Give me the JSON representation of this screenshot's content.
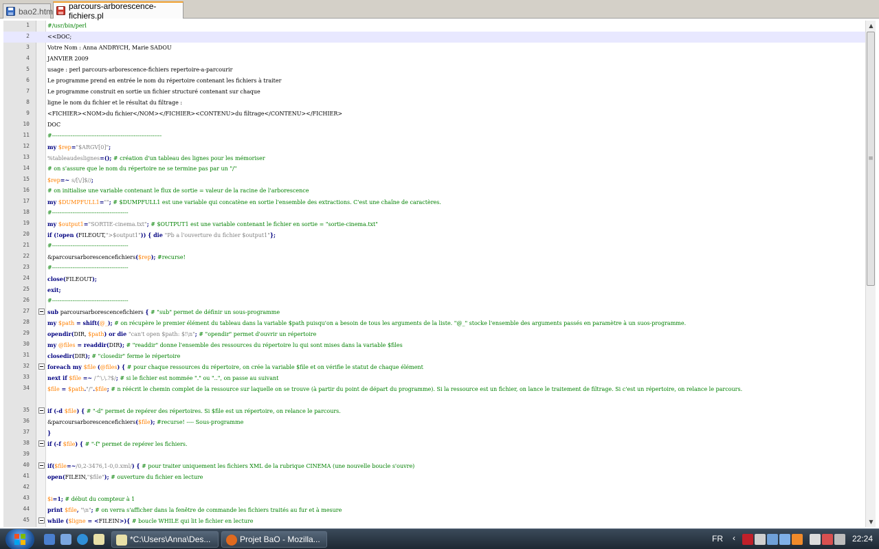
{
  "tabs": [
    {
      "label": "bao2.htm",
      "active": false
    },
    {
      "label": "parcours-arborescence-fichiers.pl",
      "active": true
    }
  ],
  "editor": {
    "current_line": 2,
    "lines": [
      {
        "n": "1",
        "fold": false,
        "segs": [
          [
            "comment",
            "#/usr/bin/perl"
          ]
        ]
      },
      {
        "n": "2",
        "fold": false,
        "segs": [
          [
            "plain",
            "<<DOC;"
          ]
        ]
      },
      {
        "n": "3",
        "fold": false,
        "segs": [
          [
            "plain",
            "Votre Nom : Anna ANDRYCH, Marie SADOU"
          ]
        ]
      },
      {
        "n": "4",
        "fold": false,
        "segs": [
          [
            "plain",
            "JANVIER 2009"
          ]
        ]
      },
      {
        "n": "5",
        "fold": false,
        "segs": [
          [
            "plain",
            "usage : perl parcours-arborescence-fichiers repertoire-a-parcourir"
          ]
        ]
      },
      {
        "n": "6",
        "fold": false,
        "segs": [
          [
            "plain",
            "Le programme prend en entrée le nom du répertoire contenant les fichiers à traiter"
          ]
        ]
      },
      {
        "n": "7",
        "fold": false,
        "segs": [
          [
            "plain",
            "Le programme construit en sortie un fichier structuré contenant sur chaque"
          ]
        ]
      },
      {
        "n": "8",
        "fold": false,
        "segs": [
          [
            "plain",
            "ligne le nom du fichier et le résultat du filtrage :"
          ]
        ]
      },
      {
        "n": "9",
        "fold": false,
        "segs": [
          [
            "plain",
            "<FICHIER><NOM>du fichier</NOM></FICHIER><CONTENU>du filtrage</CONTENU></FICHIER>"
          ]
        ]
      },
      {
        "n": "10",
        "fold": false,
        "segs": [
          [
            "plain",
            "DOC"
          ]
        ]
      },
      {
        "n": "11",
        "fold": false,
        "segs": [
          [
            "comment",
            "#-----------------------------------------------------------"
          ]
        ]
      },
      {
        "n": "12",
        "fold": false,
        "segs": [
          [
            "kw",
            "my "
          ],
          [
            "var",
            "$rep"
          ],
          [
            "op",
            "="
          ],
          [
            "str",
            "\"$ARGV[0]\""
          ],
          [
            "op",
            ";"
          ]
        ]
      },
      {
        "n": "13",
        "fold": false,
        "segs": [
          [
            "str",
            "%tableaudeslignes"
          ],
          [
            "op",
            "=();"
          ],
          [
            "comment",
            " # création d'un tableau des lignes pour les mémoriser"
          ]
        ]
      },
      {
        "n": "14",
        "fold": false,
        "segs": [
          [
            "comment",
            "# on s'assure que le nom du répertoire ne se termine pas par un \"/\""
          ]
        ]
      },
      {
        "n": "15",
        "fold": false,
        "segs": [
          [
            "var",
            "$rep"
          ],
          [
            "op",
            "=~ "
          ],
          [
            "str",
            "s/[\\/]$//"
          ],
          [
            "op",
            ";"
          ]
        ]
      },
      {
        "n": "16",
        "fold": false,
        "segs": [
          [
            "comment",
            "# on initialise une variable contenant le flux de sortie = valeur de la racine de l'arborescence"
          ]
        ]
      },
      {
        "n": "17",
        "fold": false,
        "segs": [
          [
            "kw",
            "my "
          ],
          [
            "var",
            "$DUMPFULL1"
          ],
          [
            "op",
            "="
          ],
          [
            "str",
            "\"\""
          ],
          [
            "op",
            ";"
          ],
          [
            "comment",
            " # $DUMPFULL1 est une variable qui concatène en sortie l'ensemble des extractions. C'est une chaîne de caractères."
          ]
        ]
      },
      {
        "n": "18",
        "fold": false,
        "segs": [
          [
            "comment",
            "#-----------------------------------------"
          ]
        ]
      },
      {
        "n": "19",
        "fold": false,
        "segs": [
          [
            "kw",
            "my "
          ],
          [
            "var",
            "$output1"
          ],
          [
            "op",
            "="
          ],
          [
            "str",
            "\"SORTIE-cinema.txt\""
          ],
          [
            "op",
            ";"
          ],
          [
            "comment",
            " # $OUTPUT1 est une variable contenant le fichier en sortie = \"sortie-cinema.txt\""
          ]
        ]
      },
      {
        "n": "20",
        "fold": false,
        "segs": [
          [
            "kw",
            "if "
          ],
          [
            "op",
            "(!"
          ],
          [
            "kw",
            "open "
          ],
          [
            "op",
            "("
          ],
          [
            "plain",
            "FILEOUT,"
          ],
          [
            "str",
            "\">$output1\""
          ],
          [
            "op",
            ")) { "
          ],
          [
            "kw",
            "die "
          ],
          [
            "str",
            "\"Pb a l'ouverture du fichier $output1\""
          ],
          [
            "op",
            "};"
          ]
        ]
      },
      {
        "n": "21",
        "fold": false,
        "segs": [
          [
            "comment",
            "#-----------------------------------------"
          ]
        ]
      },
      {
        "n": "22",
        "fold": false,
        "segs": [
          [
            "plain",
            "&parcoursarborescencefichiers"
          ],
          [
            "op",
            "("
          ],
          [
            "var",
            "$rep"
          ],
          [
            "op",
            ");"
          ],
          [
            "comment",
            " #recurse!"
          ]
        ]
      },
      {
        "n": "23",
        "fold": false,
        "segs": [
          [
            "comment",
            "#-----------------------------------------"
          ]
        ]
      },
      {
        "n": "24",
        "fold": false,
        "segs": [
          [
            "kw",
            "close"
          ],
          [
            "op",
            "("
          ],
          [
            "plain",
            "FILEOUT"
          ],
          [
            "op",
            ");"
          ]
        ]
      },
      {
        "n": "25",
        "fold": false,
        "segs": [
          [
            "kw",
            "exit"
          ],
          [
            "op",
            ";"
          ]
        ]
      },
      {
        "n": "26",
        "fold": false,
        "segs": [
          [
            "comment",
            "#-----------------------------------------"
          ]
        ]
      },
      {
        "n": "27",
        "fold": true,
        "segs": [
          [
            "kw",
            "sub "
          ],
          [
            "plain",
            "parcoursarborescencefichiers "
          ],
          [
            "op",
            "{"
          ],
          [
            "comment",
            " # \"sub\" permet de définir un sous-programme"
          ]
        ]
      },
      {
        "n": "28",
        "fold": false,
        "segs": [
          [
            "kw",
            "my "
          ],
          [
            "var",
            "$path"
          ],
          [
            "op",
            " = "
          ],
          [
            "kw",
            "shift"
          ],
          [
            "op",
            "("
          ],
          [
            "var",
            "@_"
          ],
          [
            "op",
            ");"
          ],
          [
            "comment",
            " # on récupère le premier élément du tableau dans la variable $path puisqu'on a besoin de tous les arguments de la liste. \"@_\" stocke l'ensemble des arguments passés en paramètre à un suos-programme."
          ]
        ]
      },
      {
        "n": "29",
        "fold": false,
        "segs": [
          [
            "kw",
            "opendir"
          ],
          [
            "op",
            "("
          ],
          [
            "plain",
            "DIR, "
          ],
          [
            "var",
            "$path"
          ],
          [
            "op",
            ") "
          ],
          [
            "kw",
            "or die "
          ],
          [
            "str",
            "\"can't open $path: $!\\n\""
          ],
          [
            "op",
            ";"
          ],
          [
            "comment",
            " # \"opendir\" permet d'ouvrir un répertoire"
          ]
        ]
      },
      {
        "n": "30",
        "fold": false,
        "segs": [
          [
            "kw",
            "my "
          ],
          [
            "var",
            "@files"
          ],
          [
            "op",
            " = "
          ],
          [
            "kw",
            "readdir"
          ],
          [
            "op",
            "("
          ],
          [
            "plain",
            "DIR"
          ],
          [
            "op",
            ");"
          ],
          [
            "comment",
            " # \"readdir\" donne l'ensemble des ressources du répertoire lu qui sont mises dans la variable $files"
          ]
        ]
      },
      {
        "n": "31",
        "fold": false,
        "segs": [
          [
            "kw",
            "closedir"
          ],
          [
            "op",
            "("
          ],
          [
            "plain",
            "DIR"
          ],
          [
            "op",
            ");"
          ],
          [
            "comment",
            " # \"closedir\" ferme le répertoire"
          ]
        ]
      },
      {
        "n": "32",
        "fold": true,
        "segs": [
          [
            "kw",
            "foreach my "
          ],
          [
            "var",
            "$file "
          ],
          [
            "op",
            "("
          ],
          [
            "var",
            "@files"
          ],
          [
            "op",
            ") {"
          ],
          [
            "comment",
            " # pour chaque ressources du répertoire, on crée la variable $file et on vérifie le statut de chaque élément"
          ]
        ]
      },
      {
        "n": "33",
        "fold": false,
        "segs": [
          [
            "kw",
            "next if "
          ],
          [
            "var",
            "$file "
          ],
          [
            "op",
            "=~ "
          ],
          [
            "str",
            "/^\\.\\.?$/"
          ],
          [
            "op",
            ";"
          ],
          [
            "comment",
            " # si le fichier est nommée \".\" ou \"..\", on passe au suivant"
          ]
        ]
      },
      {
        "n": "34",
        "fold": false,
        "wrap": true,
        "segs": [
          [
            "var",
            "$file"
          ],
          [
            "op",
            " = "
          ],
          [
            "var",
            "$path"
          ],
          [
            "op",
            "."
          ],
          [
            "str",
            "\"/\""
          ],
          [
            "op",
            "."
          ],
          [
            "var",
            "$file"
          ],
          [
            "op",
            ";"
          ],
          [
            "comment",
            " # n réécrit le chemin complet de la ressource sur laquelle on se trouve (à partir du point de départ du programme). Si la ressource est un fichier, on lance le traitement de filtrage. Si c'est un répertoire, on relance le parcours."
          ]
        ]
      },
      {
        "n": "35",
        "fold": true,
        "segs": [
          [
            "kw",
            "if "
          ],
          [
            "op",
            "(-d "
          ],
          [
            "var",
            "$file"
          ],
          [
            "op",
            ") {"
          ],
          [
            "comment",
            " # \"-d\" permet de repérer des répertoires. Si $file est un répertoire, on relance le parcours."
          ]
        ]
      },
      {
        "n": "36",
        "fold": false,
        "segs": [
          [
            "plain",
            "&parcoursarborescencefichiers"
          ],
          [
            "op",
            "("
          ],
          [
            "var",
            "$file"
          ],
          [
            "op",
            ");"
          ],
          [
            "comment",
            " #recurse! ---- Sous-programme"
          ]
        ]
      },
      {
        "n": "37",
        "fold": false,
        "segs": [
          [
            "op",
            "}"
          ]
        ]
      },
      {
        "n": "38",
        "fold": true,
        "segs": [
          [
            "kw",
            "if "
          ],
          [
            "op",
            "(-f "
          ],
          [
            "var",
            "$file"
          ],
          [
            "op",
            ") {"
          ],
          [
            "comment",
            " # \"-f\" permet de repérer les fichiers."
          ]
        ]
      },
      {
        "n": "39",
        "fold": false,
        "segs": []
      },
      {
        "n": "40",
        "fold": true,
        "segs": [
          [
            "kw",
            "if"
          ],
          [
            "op",
            "("
          ],
          [
            "var",
            "$file"
          ],
          [
            "op",
            "=~"
          ],
          [
            "str",
            "/0,2-3476,1-0,0.xml/"
          ],
          [
            "op",
            ") {"
          ],
          [
            "comment",
            " # pour traiter uniquement les fichiers XML de la rubrique CINEMA (une nouvelle boucle s'ouvre)"
          ]
        ]
      },
      {
        "n": "41",
        "fold": false,
        "segs": [
          [
            "kw",
            "open"
          ],
          [
            "op",
            "("
          ],
          [
            "plain",
            "FILEIN,"
          ],
          [
            "str",
            "\"$file\""
          ],
          [
            "op",
            ");"
          ],
          [
            "comment",
            " # ouverture du fichier en lecture"
          ]
        ]
      },
      {
        "n": "42",
        "fold": false,
        "segs": []
      },
      {
        "n": "43",
        "fold": false,
        "segs": [
          [
            "var",
            "$i"
          ],
          [
            "op",
            "=1;"
          ],
          [
            "comment",
            " # début du compteur à 1"
          ]
        ]
      },
      {
        "n": "44",
        "fold": false,
        "segs": [
          [
            "kw",
            "print "
          ],
          [
            "var",
            "$file"
          ],
          [
            "op",
            ", "
          ],
          [
            "str",
            "\"\\n\""
          ],
          [
            "op",
            ";"
          ],
          [
            "comment",
            " # on verra s'afficher dans la fenêtre de commande les fichiers traités au fur et à mesure"
          ]
        ]
      },
      {
        "n": "45",
        "fold": true,
        "segs": [
          [
            "kw",
            "while "
          ],
          [
            "op",
            "("
          ],
          [
            "var",
            "$ligne"
          ],
          [
            "op",
            " = <"
          ],
          [
            "plain",
            "FILEIN"
          ],
          [
            "op",
            ">){"
          ],
          [
            "comment",
            " # boucle WHILE qui lit le fichier en lecture"
          ]
        ]
      }
    ]
  },
  "taskbar": {
    "tasks": [
      {
        "label": "*C:\\Users\\Anna\\Des...",
        "icon": "notepad-icon"
      },
      {
        "label": "Projet BaO - Mozilla...",
        "icon": "firefox-icon"
      }
    ],
    "language": "FR",
    "clock": "22:24"
  },
  "colors": {
    "comment": "#008000",
    "keyword": "#000080",
    "variable": "#ff8000",
    "string": "#808080"
  }
}
